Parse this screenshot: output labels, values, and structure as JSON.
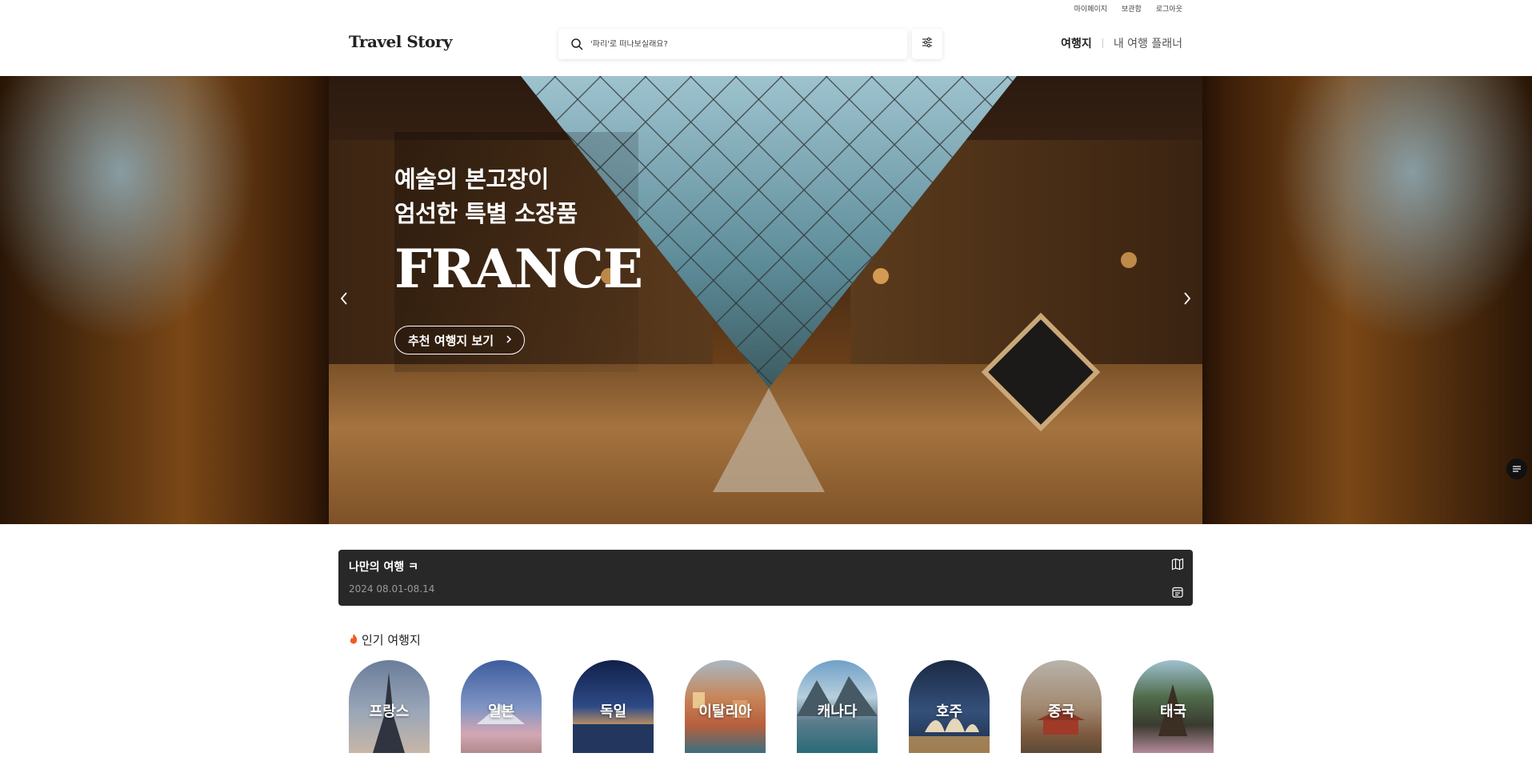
{
  "util_links": [
    "마이페이지",
    "보관함",
    "로그아웃"
  ],
  "header": {
    "logo": "Travel Story",
    "search_placeholder": "'파리'로 떠나보실래요?",
    "nav": {
      "destinations": "여행지",
      "planner": "내 여행 플래너"
    }
  },
  "hero": {
    "subtitle_line1": "예술의 본고장이",
    "subtitle_line2": "엄선한 특별 소장품",
    "title": "FRANCE",
    "cta": "추천 여행지 보기"
  },
  "trip": {
    "title": "나만의 여행 ㅋ",
    "dates": "2024 08.01-08.14"
  },
  "popular": {
    "heading": "인기 여행지",
    "destinations": [
      "프랑스",
      "일본",
      "독일",
      "이탈리아",
      "캐나다",
      "호주",
      "중국",
      "태국"
    ]
  },
  "colors": {
    "trip_bar": "#282828",
    "fire_icon": "#f25c1e"
  },
  "icons": [
    "search-icon",
    "filter-icon",
    "chevron-left-icon",
    "chevron-right-icon",
    "map-icon",
    "calendar-icon",
    "fire-icon",
    "menu-icon"
  ]
}
